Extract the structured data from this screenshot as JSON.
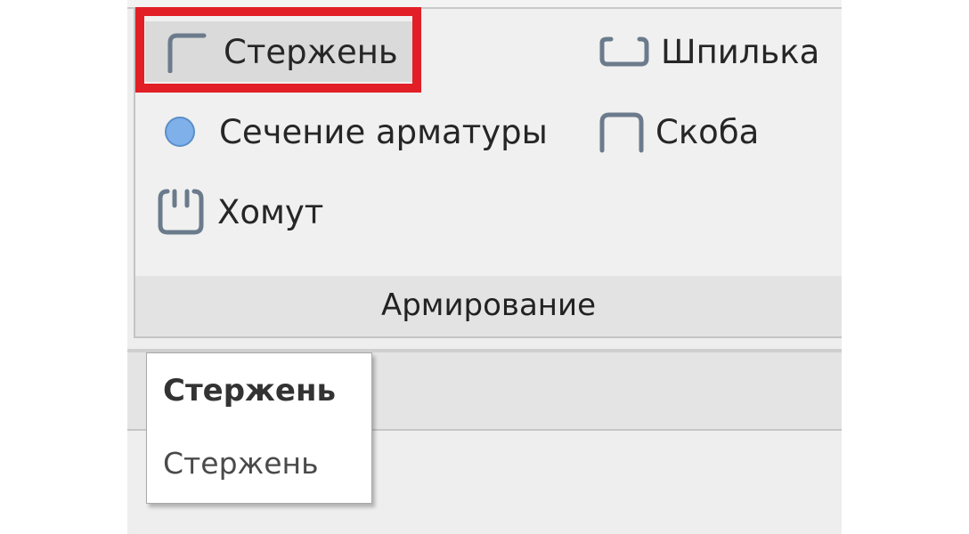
{
  "ribbon": {
    "panel_title": "Армирование",
    "tools": {
      "rod": {
        "label": "Стержень",
        "icon": "rebar-rod-icon",
        "highlighted": true
      },
      "hairpin": {
        "label": "Шпилька",
        "icon": "hairpin-icon"
      },
      "section": {
        "label": "Сечение арматуры",
        "icon": "rebar-section-circle-icon"
      },
      "bracket": {
        "label": "Скоба",
        "icon": "bracket-icon"
      },
      "clamp": {
        "label": "Хомут",
        "icon": "stirrup-icon"
      }
    }
  },
  "tooltip": {
    "title": "Стержень",
    "description": "Стержень"
  },
  "colors": {
    "highlight_border": "#e21f26",
    "icon_stroke": "#6b7b8c",
    "section_dot": "#7fb0ea"
  }
}
